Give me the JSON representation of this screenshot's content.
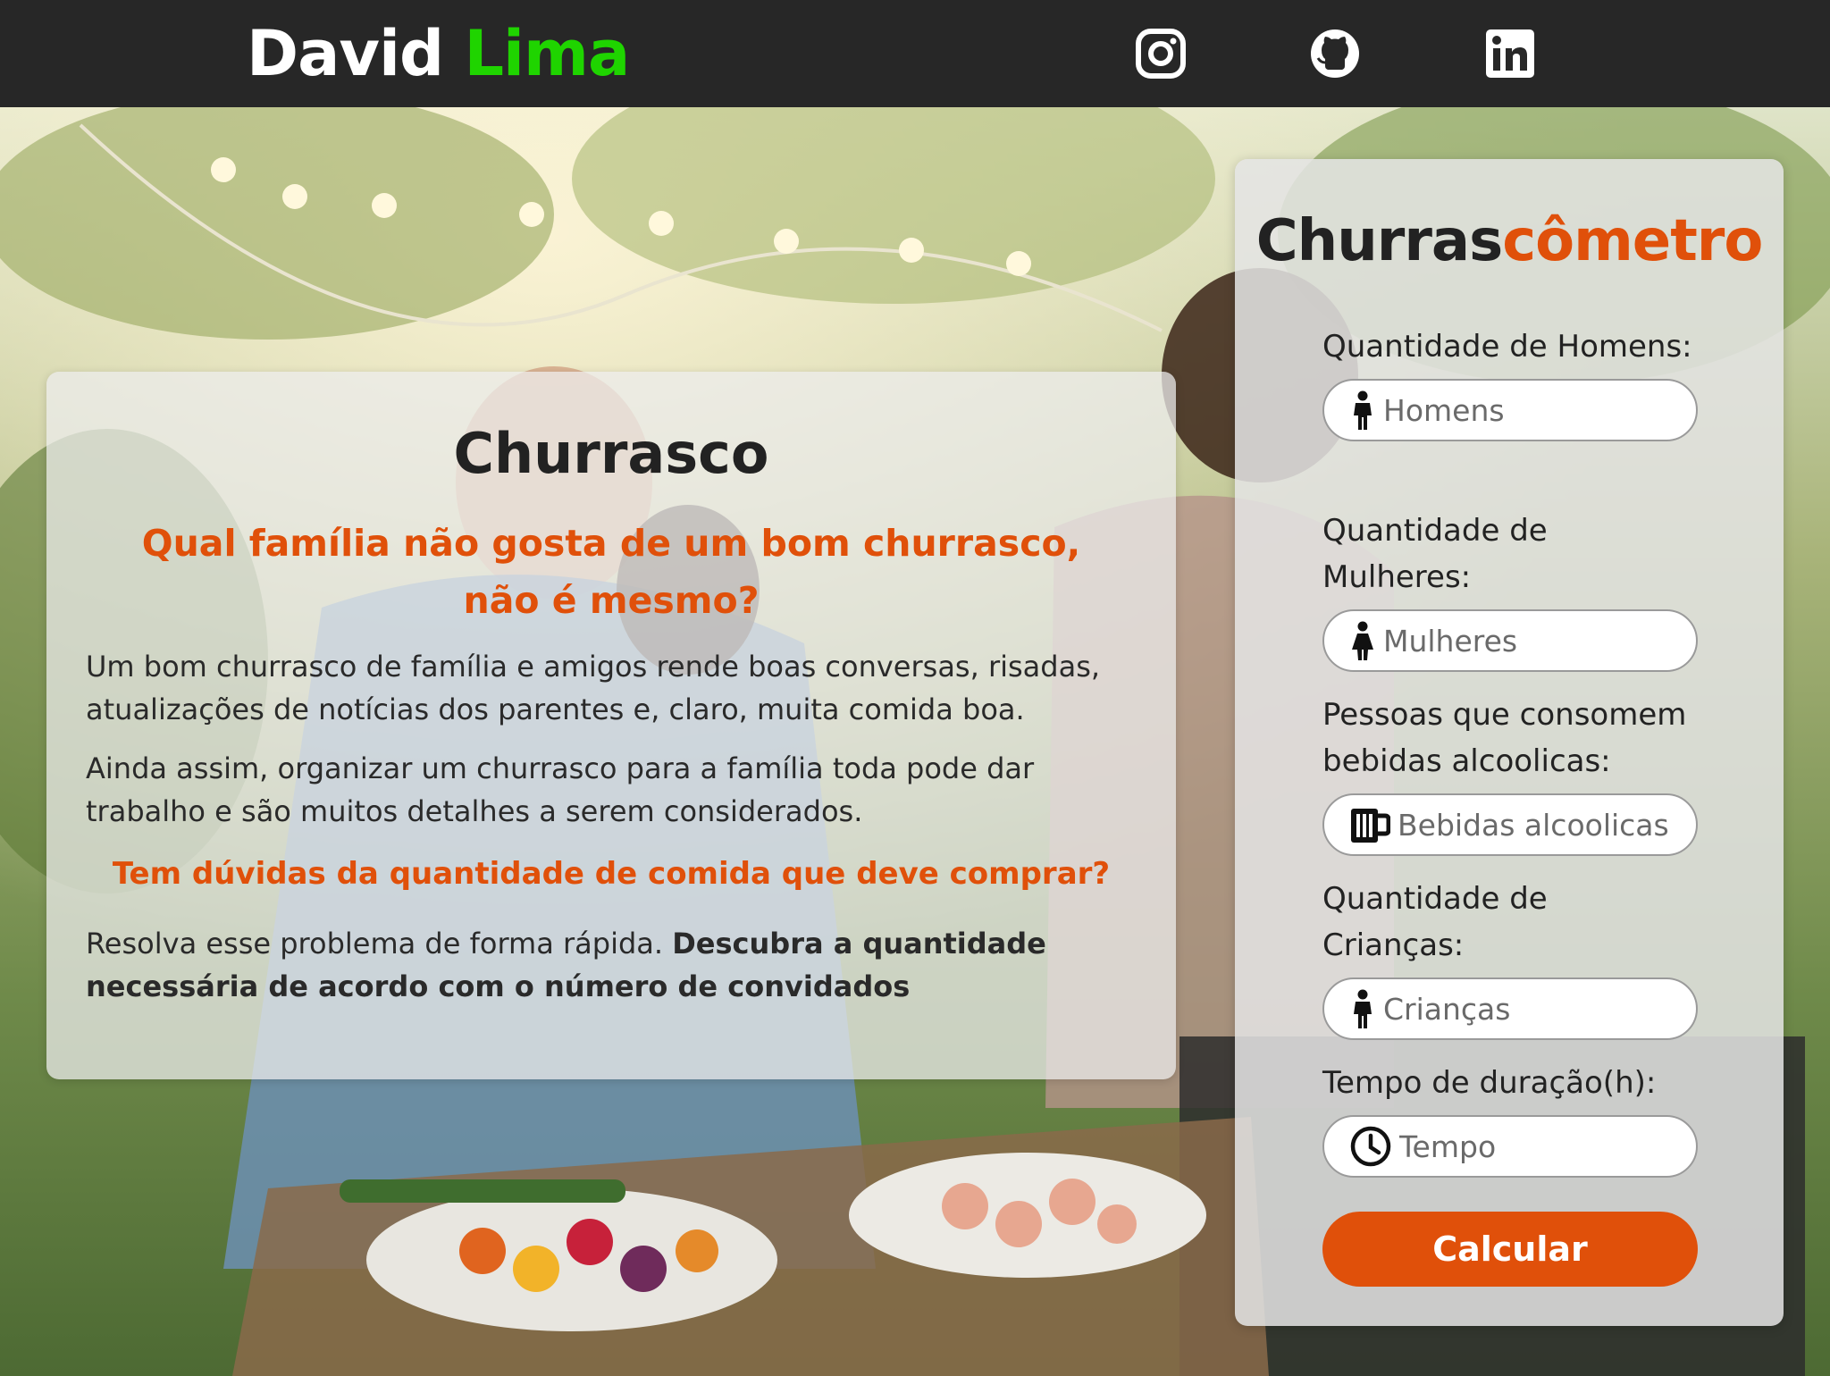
{
  "header": {
    "brand_first": "David",
    "brand_last": "Lima",
    "social": [
      {
        "icon": "instagram-icon"
      },
      {
        "icon": "github-icon"
      },
      {
        "icon": "linkedin-icon"
      }
    ]
  },
  "info": {
    "title": "Churrasco",
    "subtitle": "Qual família não gosta de um bom churrasco, não é mesmo?",
    "paragraph1": "Um bom churrasco de família e amigos rende boas conversas, risadas, atualizações de notícias dos parentes e, claro, muita comida boa.",
    "paragraph2": "Ainda assim, organizar um churrasco para a família toda pode dar trabalho e são muitos detalhes a serem considerados.",
    "question": "Tem dúvidas da quantidade de comida que deve comprar?",
    "cta_plain": "Resolva esse problema de forma rápida. ",
    "cta_bold": "Descubra a quantidade necessária de acordo com o número de convidados"
  },
  "form": {
    "title_first": "Churras",
    "title_accent": "cômetro",
    "fields": [
      {
        "label": "Quantidade de Homens:",
        "placeholder": "Homens",
        "icon": "male-person-icon"
      },
      {
        "label": "Quantidade de Mulheres:",
        "placeholder": "Mulheres",
        "icon": "female-person-icon"
      },
      {
        "label": "Pessoas que consomem bebidas alcoolicas:",
        "placeholder": "Bebidas alcoolicas",
        "icon": "beer-mug-icon"
      },
      {
        "label": "Quantidade de Crianças:",
        "placeholder": "Crianças",
        "icon": "child-icon"
      },
      {
        "label": "Tempo de duração(h):",
        "placeholder": "Tempo",
        "icon": "clock-icon"
      }
    ],
    "button_label": "Calcular"
  },
  "colors": {
    "header_bg": "#272727",
    "brand_accent": "#1fd400",
    "accent": "#e0500a"
  }
}
